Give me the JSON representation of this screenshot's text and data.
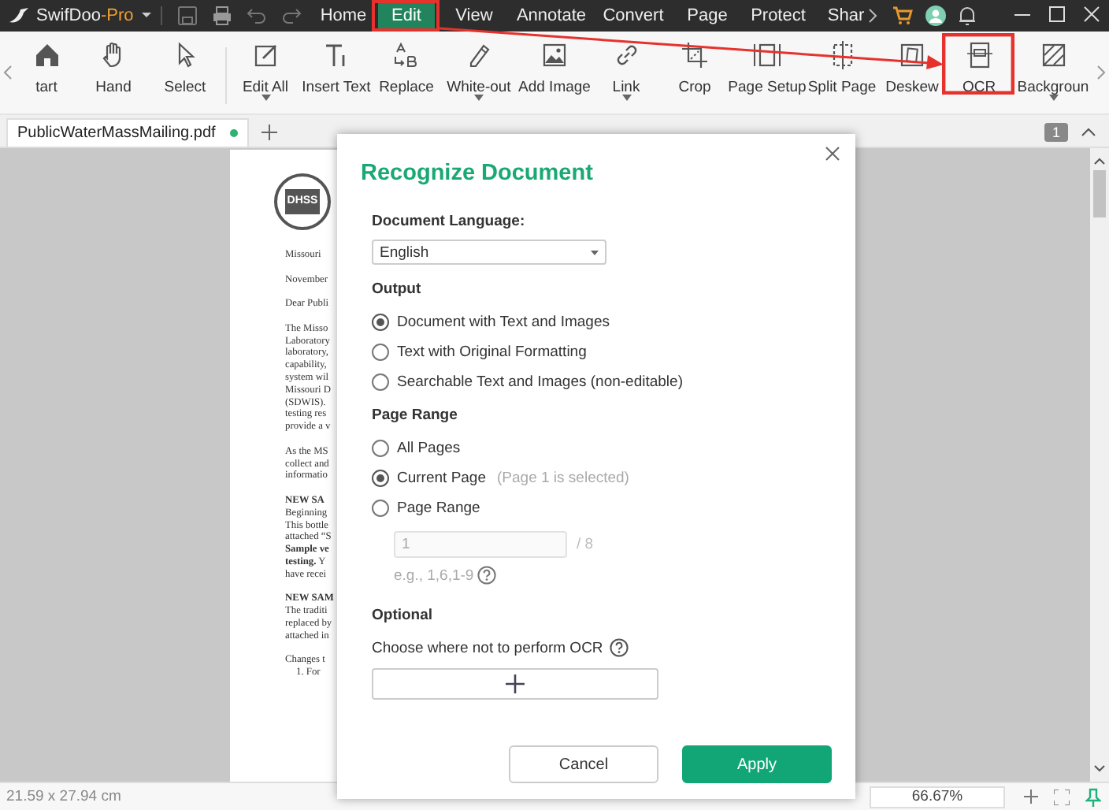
{
  "app": {
    "name": "SwifDoo",
    "edition": "-Pro"
  },
  "menu": [
    {
      "label": "Home",
      "selected": false
    },
    {
      "label": "Edit",
      "selected": true
    },
    {
      "label": "View",
      "selected": false
    },
    {
      "label": "Annotate",
      "selected": false
    },
    {
      "label": "Convert",
      "selected": false
    },
    {
      "label": "Page",
      "selected": false
    },
    {
      "label": "Protect",
      "selected": false
    },
    {
      "label": "Shar",
      "selected": false
    }
  ],
  "toolbar": [
    {
      "label": "tart",
      "dropdown": false
    },
    {
      "label": "Hand",
      "dropdown": false
    },
    {
      "label": "Select",
      "dropdown": false
    },
    {
      "label": "Edit All",
      "dropdown": true
    },
    {
      "label": "Insert Text",
      "dropdown": false
    },
    {
      "label": "Replace",
      "dropdown": false
    },
    {
      "label": "White-out",
      "dropdown": true
    },
    {
      "label": "Add Image",
      "dropdown": false
    },
    {
      "label": "Link",
      "dropdown": true
    },
    {
      "label": "Crop",
      "dropdown": false
    },
    {
      "label": "Page Setup",
      "dropdown": false
    },
    {
      "label": "Split Page",
      "dropdown": false
    },
    {
      "label": "Deskew",
      "dropdown": false
    },
    {
      "label": "OCR",
      "dropdown": false
    },
    {
      "label": "Backgroun",
      "dropdown": true
    }
  ],
  "file_tabs": [
    {
      "label": "PublicWaterMassMailing.pdf",
      "selected": true,
      "modified": true
    }
  ],
  "page_badge": "1",
  "document": {
    "logo_text": "DHSS",
    "paragraphs": [
      {
        "lines": [
          {
            "text": "Missouri",
            "bold": false
          }
        ]
      },
      {
        "lines": [
          {
            "text": "November",
            "bold": false
          }
        ]
      },
      {
        "lines": [
          {
            "text": "Dear Publi",
            "bold": false
          }
        ]
      },
      {
        "lines": [
          {
            "text": "The Misso",
            "bold": false
          },
          {
            "text": "Laboratory",
            "bold": false
          },
          {
            "text": "laboratory,",
            "bold": false
          },
          {
            "text": "capability,",
            "bold": false
          },
          {
            "text": "system wil",
            "bold": false
          },
          {
            "text": "Missouri D",
            "bold": false
          },
          {
            "text": "(SDWIS).",
            "bold": false
          },
          {
            "text": "testing res",
            "bold": false
          },
          {
            "text": "provide a v",
            "bold": false
          }
        ]
      },
      {
        "lines": [
          {
            "text": "As the MS",
            "bold": false
          },
          {
            "text": "collect and",
            "bold": false
          },
          {
            "text": "informatio",
            "bold": false
          }
        ]
      },
      {
        "lines": [
          {
            "text": "NEW SA",
            "bold": true
          },
          {
            "text": "Beginning",
            "bold": false
          },
          {
            "text": "This bottle",
            "bold": false
          },
          {
            "text": "attached “S",
            "bold": false
          },
          {
            "text": "Sample ve",
            "bold": true
          },
          {
            "text": "**testing.** Y",
            "bold": false
          },
          {
            "text": "have recei",
            "bold": false
          }
        ]
      },
      {
        "lines": [
          {
            "text": "NEW SAM",
            "bold": true
          },
          {
            "text": "The traditi",
            "bold": false
          },
          {
            "text": "replaced by",
            "bold": false
          },
          {
            "text": "attached in",
            "bold": false
          }
        ]
      },
      {
        "lines": [
          {
            "text": "Changes t",
            "bold": false
          },
          {
            "text": "1.  For",
            "bold": false
          }
        ]
      }
    ]
  },
  "dialog": {
    "title": "Recognize Document",
    "language_label": "Document Language:",
    "language": "English",
    "output_label": "Output",
    "output_options": [
      {
        "label": "Document with Text and Images",
        "selected": true
      },
      {
        "label": "Text with Original Formatting",
        "selected": false
      },
      {
        "label": "Searchable Text and Images (non-editable)",
        "selected": false
      }
    ],
    "range_label": "Page Range",
    "range_options": [
      {
        "label": "All Pages",
        "selected": false
      },
      {
        "label": "Current Page",
        "note": "(Page 1 is selected)",
        "selected": true
      },
      {
        "label": "Page Range",
        "selected": false
      }
    ],
    "range_input": {
      "value": "1",
      "total": "/ 8",
      "disabled": true
    },
    "range_hint": "e.g., 1,6,1-9",
    "optional_label": "Optional",
    "exclude_label": "Choose where not to perform OCR",
    "buttons": [
      {
        "label": "Cancel",
        "kind": "secondary"
      },
      {
        "label": "Apply",
        "kind": "primary"
      }
    ]
  },
  "status_bar": {
    "size": "21.59 x 27.94 cm",
    "zoom": "66.67%"
  }
}
